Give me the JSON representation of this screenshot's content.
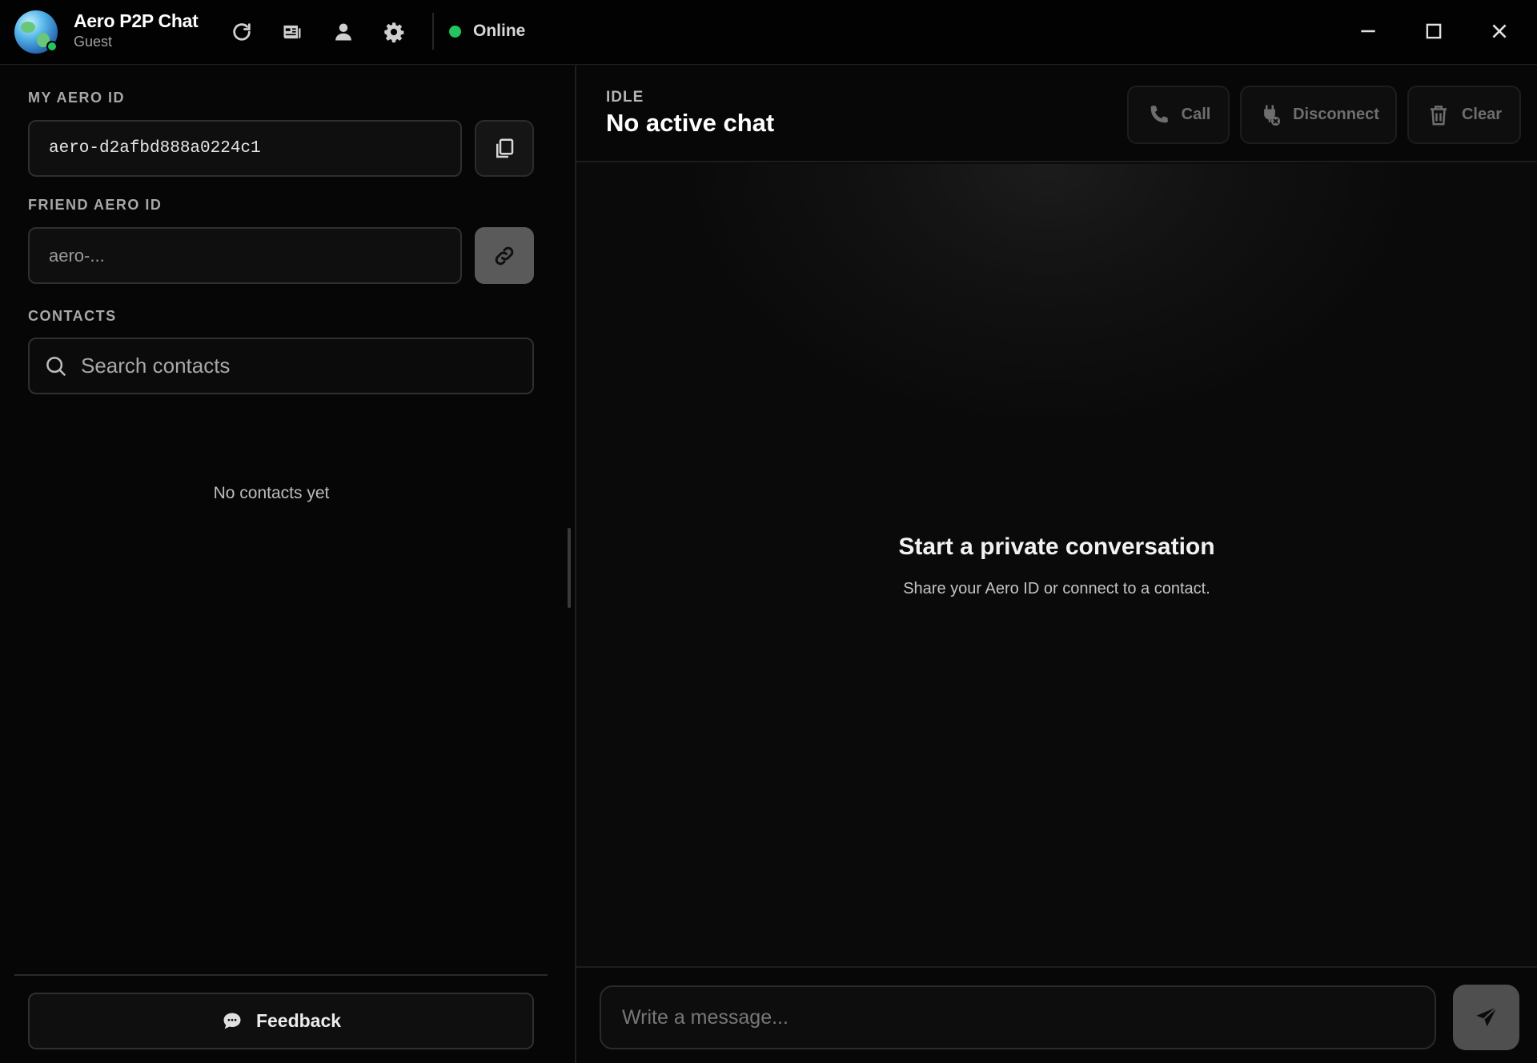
{
  "app": {
    "title": "Aero P2P Chat",
    "user": "Guest",
    "status": "Online",
    "colors": {
      "online": "#22c55e",
      "background": "#090909",
      "accent_button": "#5a5a5a"
    }
  },
  "toolbar": {
    "icons": [
      "refresh-icon",
      "news-icon",
      "profile-icon",
      "settings-icon"
    ]
  },
  "window_controls": [
    "minimize-icon",
    "maximize-icon",
    "close-icon"
  ],
  "sidebar": {
    "my_id_label": "MY AERO ID",
    "my_id_value": "aero-d2afbd888a0224c1",
    "friend_id_label": "FRIEND AERO ID",
    "friend_id_placeholder": "aero-...",
    "contacts_label": "CONTACTS",
    "search_placeholder": "Search contacts",
    "empty_contacts": "No contacts yet",
    "feedback_label": "Feedback"
  },
  "chat": {
    "state": "IDLE",
    "title": "No active chat",
    "actions": {
      "call": "Call",
      "disconnect": "Disconnect",
      "clear": "Clear"
    },
    "empty_title": "Start a private conversation",
    "empty_subtitle": "Share your Aero ID or connect to a contact.",
    "message_placeholder": "Write a message..."
  }
}
